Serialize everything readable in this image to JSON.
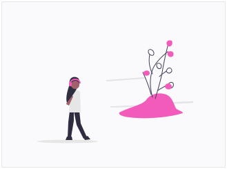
{
  "illustration": {
    "subject": "person-with-headphones-and-plant",
    "colors": {
      "background": "#fafafc",
      "border": "#e6e6ea",
      "accent": "#f35bbb",
      "skin": "#a0616a",
      "hair": "#2f2e41",
      "shirt": "#e6e6e6",
      "pants": "#2f2e41",
      "shadow": "#e6e6e6",
      "stem": "#3f3d56"
    }
  }
}
